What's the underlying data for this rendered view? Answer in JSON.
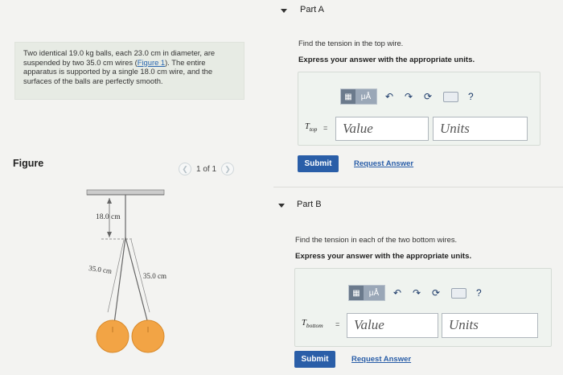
{
  "problem": {
    "text_pre": "Two identical 19.0 kg balls, each 23.0 cm in diameter, are suspended by two 35.0 cm wires (",
    "figure_link": "Figure 1",
    "text_post": "). The entire apparatus is supported by a single 18.0 cm wire, and the surfaces of the balls are perfectly smooth."
  },
  "figure": {
    "title": "Figure",
    "pager": "1 of 1",
    "prev_icon": "chevron-left-icon",
    "next_icon": "chevron-right-icon",
    "top_wire_label": "18.0 cm",
    "left_wire_label": "35.0 cm",
    "right_wire_label": "35.0 cm",
    "ball_color": "#f2a445"
  },
  "partA": {
    "title": "Part A",
    "question": "Find the tension in the top wire.",
    "instruction": "Express your answer with the appropriate units.",
    "var_main": "T",
    "var_sub": "top",
    "equals": "=",
    "value_placeholder": "Value",
    "units_placeholder": "Units",
    "submit_label": "Submit",
    "request_label": "Request Answer"
  },
  "partB": {
    "title": "Part B",
    "question": "Find the tension in each of the two bottom wires.",
    "instruction": "Express your answer with the appropriate units.",
    "var_main": "T",
    "var_sub": "bottom",
    "equals": "=",
    "value_placeholder": "Value",
    "units_placeholder": "Units",
    "submit_label": "Submit",
    "request_label": "Request Answer"
  },
  "toolbar": {
    "units_button": "μÅ",
    "help": "?",
    "icons": [
      "templates-icon",
      "units-icon",
      "undo-icon",
      "redo-icon",
      "reset-icon",
      "keyboard-icon",
      "help-icon"
    ]
  },
  "colors": {
    "accent": "#2a5ea8",
    "panel": "#eff3ef",
    "problem_bg": "#e7ebe4"
  }
}
